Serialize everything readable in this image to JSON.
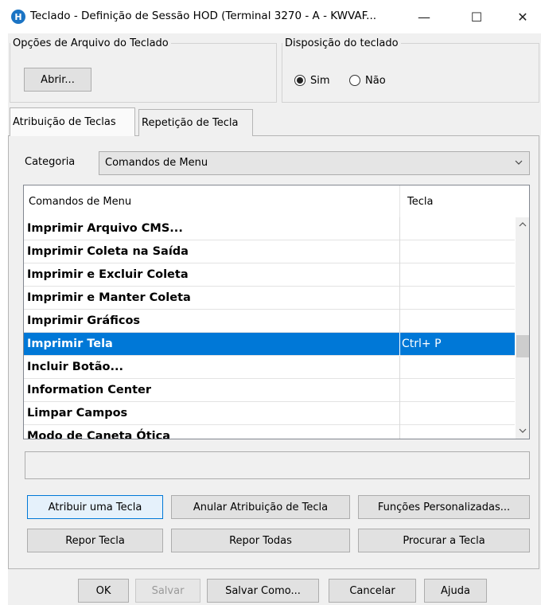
{
  "window": {
    "title": "Teclado - Definição de Sessão HOD (Terminal 3270 - A - KWVAF...",
    "icon_letter": "H",
    "minimize": "—",
    "maximize": "☐",
    "close": "✕"
  },
  "file_options": {
    "legend": "Opções de Arquivo do Teclado",
    "open_button": "Abrir..."
  },
  "layout": {
    "legend": "Disposição do teclado",
    "options": [
      "Sim",
      "Não"
    ],
    "selected": "Sim"
  },
  "tabs": [
    {
      "label": "Atribuição de Teclas",
      "active": true
    },
    {
      "label": "Repetição de Tecla",
      "active": false
    }
  ],
  "category": {
    "label": "Categoria",
    "value": "Comandos de Menu"
  },
  "table": {
    "headers": [
      "Comandos de Menu",
      "Tecla"
    ],
    "rows": [
      {
        "command": "Imprimir Arquivo CMS...",
        "key": ""
      },
      {
        "command": "Imprimir Coleta na Saída",
        "key": ""
      },
      {
        "command": "Imprimir e Excluir Coleta",
        "key": ""
      },
      {
        "command": "Imprimir e Manter Coleta",
        "key": ""
      },
      {
        "command": "Imprimir Gráficos",
        "key": ""
      },
      {
        "command": "Imprimir Tela",
        "key": "Ctrl+ P",
        "selected": true
      },
      {
        "command": "Incluir Botão...",
        "key": ""
      },
      {
        "command": "Information Center",
        "key": ""
      },
      {
        "command": "Limpar Campos",
        "key": ""
      },
      {
        "command": "Modo de Caneta Ótica",
        "key": ""
      }
    ]
  },
  "actions": {
    "assign": "Atribuir uma Tecla",
    "unassign": "Anular Atribuição de Tecla",
    "custom": "Funções Personalizadas...",
    "reset_key": "Repor Tecla",
    "reset_all": "Repor Todas",
    "find_key": "Procurar a Tecla"
  },
  "dialog_buttons": {
    "ok": "OK",
    "save": "Salvar",
    "save_as": "Salvar Como...",
    "cancel": "Cancelar",
    "help": "Ajuda"
  },
  "colors": {
    "selection": "#0078d7",
    "app_icon": "#1b74c4"
  }
}
